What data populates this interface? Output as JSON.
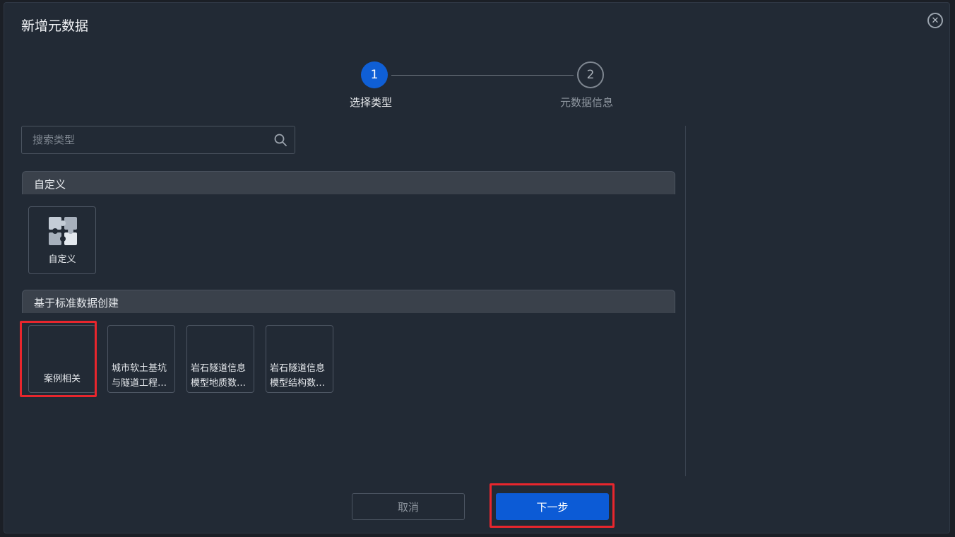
{
  "dialog": {
    "title": "新增元数据",
    "close_icon": "close-circle-icon"
  },
  "steps": [
    {
      "number": "1",
      "label": "选择类型",
      "state": "active"
    },
    {
      "number": "2",
      "label": "元数据信息",
      "state": "pending"
    }
  ],
  "search": {
    "placeholder": "搜索类型",
    "value": "",
    "icon": "search-icon"
  },
  "sections": [
    {
      "title": "自定义",
      "items": [
        {
          "label": "自定义",
          "icon": "puzzle-icon"
        }
      ]
    },
    {
      "title": "基于标准数据创建",
      "items": [
        {
          "label": "案例相关"
        },
        {
          "line1": "城市软土基坑",
          "line2": "与隧道工程…"
        },
        {
          "line1": "岩石隧道信息",
          "line2": "模型地质数…"
        },
        {
          "line1": "岩石隧道信息",
          "line2": "模型结构数…"
        }
      ]
    }
  ],
  "buttons": {
    "cancel": "取消",
    "next": "下一步"
  },
  "colors": {
    "accent": "#0c5bd6",
    "highlight": "#e8262d",
    "background": "#222a35"
  }
}
